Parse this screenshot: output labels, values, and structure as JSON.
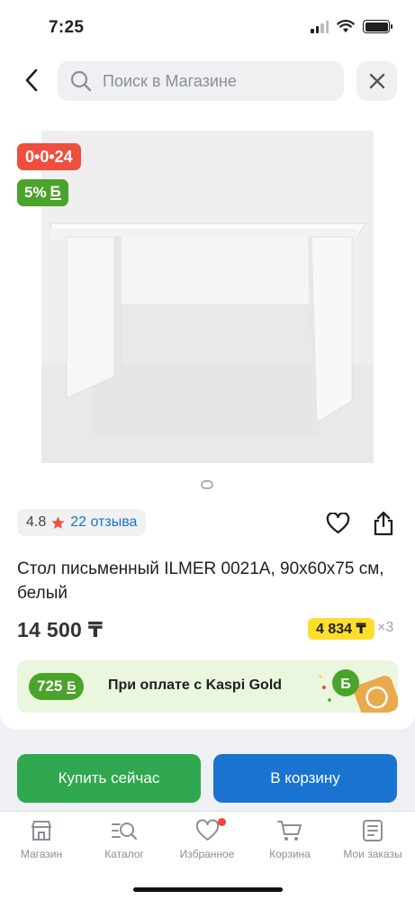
{
  "status_bar": {
    "time": "7:25"
  },
  "header": {
    "search_placeholder": "Поиск в Магазине"
  },
  "badges": {
    "timer": "0•0•24",
    "bonus": "5%"
  },
  "rating": {
    "value": "4.8",
    "reviews": "22 отзыва"
  },
  "product": {
    "title": "Стол письменный ILMER 0021A, 90x60x75 см, белый",
    "price": "14 500 ₸",
    "installment": "4 834 ₸",
    "installment_months": "×3"
  },
  "kaspi_gold": {
    "bonus": "725",
    "text": "При оплате с Kaspi Gold"
  },
  "actions": {
    "buy_now": "Купить сейчас",
    "add_to_cart": "В корзину"
  },
  "tabbar": {
    "items": [
      {
        "label": "Магазин",
        "icon": "shop-icon"
      },
      {
        "label": "Каталог",
        "icon": "catalog-icon"
      },
      {
        "label": "Избранное",
        "icon": "heart-icon"
      },
      {
        "label": "Корзина",
        "icon": "cart-icon"
      },
      {
        "label": "Мои заказы",
        "icon": "orders-icon"
      }
    ]
  },
  "colors": {
    "green": "#2fa84f",
    "blue": "#1a73d1",
    "red": "#f04e3e",
    "yellow": "#ffde2b"
  }
}
